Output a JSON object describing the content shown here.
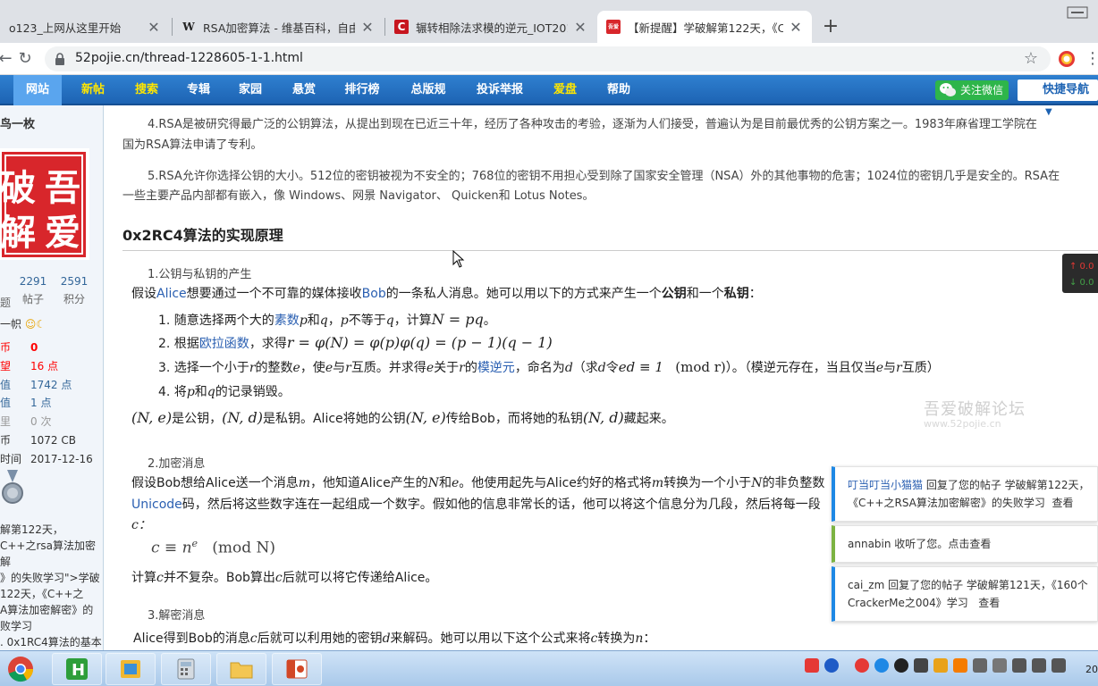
{
  "tabs": [
    {
      "title": "o123_上网从这里开始",
      "favicon": "",
      "active": false
    },
    {
      "title": "RSA加密算法 - 维基百科，自由的",
      "favicon": "W",
      "active": false
    },
    {
      "title": "辗转相除法求模的逆元_IOT2017",
      "favicon": "C",
      "active": false
    },
    {
      "title": "【新提醒】学破解第122天，《C",
      "favicon": "吾爱",
      "active": true
    }
  ],
  "new_tab": "+",
  "url": "52pojie.cn/thread-1228605-1-1.html",
  "nav": {
    "items": [
      "网站",
      "新帖",
      "搜索",
      "专辑",
      "家园",
      "悬赏",
      "排行榜",
      "总版规",
      "投诉举报",
      "爱盘",
      "帮助"
    ],
    "wechat": "关注微信",
    "quick_nav": "快捷导航"
  },
  "sidebar": {
    "username": "鸟一枚",
    "avatar_text": [
      "吾",
      "破",
      "爱",
      "解"
    ],
    "stats": [
      {
        "num": "2291",
        "label": "帖子"
      },
      {
        "num": "2591",
        "label": "积分"
      }
    ],
    "stat_left_label": "题",
    "title_line": "一帜",
    "rows": [
      {
        "k": "币",
        "v": "0"
      },
      {
        "k": "望",
        "v": "16 点"
      },
      {
        "k": "值",
        "v": "1742 点"
      },
      {
        "k": "值",
        "v": "1 点"
      },
      {
        "k": "里",
        "v": "0 次"
      },
      {
        "k": "币",
        "v": "1072 CB"
      },
      {
        "k": "时间",
        "v": "2017-12-16"
      }
    ],
    "links": "解第122天，\nC++之rsa算法加密解\n》的失败学习\">学破\n122天，《C++之\nA算法加密解密》的\n败学习\n. 0x1RC4算法的基本"
  },
  "article": {
    "p4_line1": "4.RSA是被研究得最广泛的公钥算法，从提出到现在已近三十年，经历了各种攻击的考验，逐渐为人们接受，普遍认为是目前最优秀的公钥方案之一。1983年麻省理工学院在",
    "p4_line2": "国为RSA算法申请了专利。",
    "p5_line1": "5.RSA允许你选择公钥的大小。512位的密钥被视为不安全的；768位的密钥不用担心受到除了国家安全管理（NSA）外的其他事物的危害；1024位的密钥几乎是安全的。RSA在",
    "p5_line2": "一些主要产品内部都有嵌入，像 Windows、网景 Navigator、 Quicken和 Lotus Notes。",
    "heading": "0x2RC4算法的实现原理",
    "s1_title": "1.公钥与私钥的产生",
    "s1_intro_a": "假设",
    "s1_intro_alice": "Alice",
    "s1_intro_b": "想要通过一个不可靠的媒体接收",
    "s1_intro_bob": "Bob",
    "s1_intro_c": "的一条私人消息。她可以用以下的方式来产生一个",
    "s1_intro_pub": "公钥",
    "s1_intro_and": "和一个",
    "s1_intro_priv": "私钥",
    "s1_intro_end": "：",
    "li1_a": "1. 随意选择两个大的",
    "li1_link": "素数",
    "li1_b": "p",
    "li1_c": "和",
    "li1_d": "q",
    "li1_e": "，",
    "li1_f": "p",
    "li1_g": "不等于",
    "li1_h": "q",
    "li1_i": "，计算",
    "li1_j": "N = pq",
    "li1_k": "。",
    "li2_a": "2. 根据",
    "li2_link": "欧拉函数",
    "li2_b": "，求得",
    "li2_c": "r = φ(N) = φ(p)φ(q) = (p − 1)(q − 1)",
    "li3_a": "3. 选择一个小于",
    "li3_r": "r",
    "li3_b": "的整数",
    "li3_e": "e",
    "li3_c": "，使",
    "li3_e2": "e",
    "li3_d": "与",
    "li3_r2": "r",
    "li3_f": "互质。并求得",
    "li3_e3": "e",
    "li3_g": "关于",
    "li3_r3": "r",
    "li3_h": "的",
    "li3_link": "模逆元",
    "li3_i": "，命名为",
    "li3_d2": "d",
    "li3_j": "（求",
    "li3_k": "d",
    "li3_l": "令",
    "li3_m": "ed ≡ 1",
    "li3_n": "(mod  r)",
    "li3_o": "）。（模逆元存在，当且仅当",
    "li3_e4": "e",
    "li3_p": "与",
    "li3_r4": "r",
    "li3_q": "互质）",
    "li4_a": "4. 将",
    "li4_p": "p",
    "li4_b": "和",
    "li4_q": "q",
    "li4_c": "的记录销毁。",
    "keys_a": "(N, e)",
    "keys_b": "是公钥，",
    "keys_c": "(N, d)",
    "keys_d": "是私钥。Alice将她的公钥",
    "keys_e": "(N, e)",
    "keys_f": "传给Bob，而将她的私钥",
    "keys_g": "(N, d)",
    "keys_h": "藏起来。",
    "s2_title": "2.加密消息",
    "s2_l1_a": "假设Bob想给Alice送一个消息",
    "s2_l1_m": "m",
    "s2_l1_b": "，他知道Alice产生的",
    "s2_l1_N": "N",
    "s2_l1_c": "和",
    "s2_l1_e": "e",
    "s2_l1_d": "。他使用起先与Alice约好的格式将",
    "s2_l1_m2": "m",
    "s2_l1_f": "转换为一个小于",
    "s2_l1_N2": "N",
    "s2_l1_g": "的非负整数",
    "s2_l2_link": "Unicode",
    "s2_l2_a": "码，然后将这些数字连在一起组成一个数字。假如他的信息非常长的话，他可以将这个信息分为几段，然后将每一段",
    "s2_l3": "c：",
    "s2_formula_a": "c ≡ n",
    "s2_formula_sup": "e",
    "s2_formula_b": "(mod  N)",
    "s2_after_a": "计算",
    "s2_after_c": "c",
    "s2_after_b": "并不复杂。Bob算出",
    "s2_after_c2": "c",
    "s2_after_d": "后就可以将它传递给Alice。",
    "s3_title": "3.解密消息",
    "s3_l1_a": "Alice得到Bob的消息",
    "s3_l1_c": "c",
    "s3_l1_b": "后就可以利用她的密钥",
    "s3_l1_d": "d",
    "s3_l1_e": "来解码。她可以用以下这个公式来将",
    "s3_l1_c2": "c",
    "s3_l1_f": "转换为",
    "s3_l1_n": "n",
    "s3_l1_g": "："
  },
  "watermark": "吾爱破解论坛",
  "watermark_url": "www.52pojie.cn",
  "notifications": [
    {
      "user": "叮当叮当小猫猫",
      "text": " 回复了您的帖子 学破解第122天，",
      "text2": "《C++之RSA算法加密解密》的失败学习",
      "action": "查看"
    },
    {
      "user": "annabin",
      "text": " 收听了您。",
      "action": "点击查看"
    },
    {
      "user": "cai_zm",
      "text": " 回复了您的帖子 学破解第121天，《160个",
      "text2": "CrackerMe之004》学习",
      "action": "查看"
    }
  ],
  "ticker": {
    "up": "↑ 0.0",
    "down": "↓ 0.0"
  },
  "clock": "20",
  "colors": {
    "nav_blue": "#1d63b3",
    "link_blue": "#2a5fb1",
    "notif_blue": "#1e88e5",
    "notif_green": "#7cb342"
  }
}
